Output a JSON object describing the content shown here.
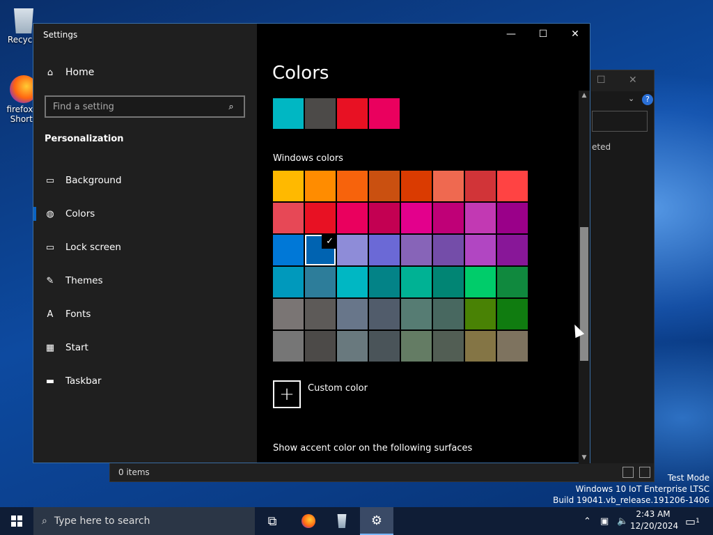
{
  "desktop": {
    "icons": [
      {
        "label": "Recycle"
      },
      {
        "label": "firefox.e Shortc"
      }
    ]
  },
  "explorer": {
    "column_fragment": "eted",
    "status_text": "0 items",
    "caption_maximize": "☐",
    "caption_close": "✕"
  },
  "settings": {
    "app_title": "Settings",
    "home_label": "Home",
    "search_placeholder": "Find a setting",
    "section_title": "Personalization",
    "nav": [
      {
        "label": "Background",
        "icon": "picture-icon",
        "glyph": "▭"
      },
      {
        "label": "Colors",
        "icon": "palette-icon",
        "glyph": "◍"
      },
      {
        "label": "Lock screen",
        "icon": "lock-screen-icon",
        "glyph": "▭"
      },
      {
        "label": "Themes",
        "icon": "themes-icon",
        "glyph": "✎"
      },
      {
        "label": "Fonts",
        "icon": "fonts-icon",
        "glyph": "A"
      },
      {
        "label": "Start",
        "icon": "start-icon",
        "glyph": "▦"
      },
      {
        "label": "Taskbar",
        "icon": "taskbar-icon",
        "glyph": "▬"
      }
    ],
    "active_nav": "Colors",
    "page_title": "Colors",
    "recent_colors": [
      "#00B7C3",
      "#4C4A48",
      "#E81123",
      "#EA005E"
    ],
    "windows_colors_label": "Windows colors",
    "windows_colors": [
      [
        "#FFB900",
        "#FF8C00",
        "#F7630C",
        "#CA5010",
        "#DA3B01",
        "#EF6950",
        "#D13438",
        "#FF4343"
      ],
      [
        "#E74856",
        "#E81123",
        "#EA005E",
        "#C30052",
        "#E3008C",
        "#BF0077",
        "#C239B3",
        "#9A0089"
      ],
      [
        "#0078D7",
        "#0063B1",
        "#8E8CD8",
        "#6B69D6",
        "#8764B8",
        "#744DA9",
        "#B146C2",
        "#881798"
      ],
      [
        "#0099BC",
        "#2D7D9A",
        "#00B7C3",
        "#038387",
        "#00B294",
        "#018574",
        "#00CC6A",
        "#10893E"
      ],
      [
        "#7A7574",
        "#5D5A58",
        "#68768A",
        "#515C6B",
        "#567C73",
        "#486860",
        "#498205",
        "#107C10"
      ],
      [
        "#767676",
        "#4C4A48",
        "#69797E",
        "#4A5459",
        "#647C64",
        "#525E54",
        "#847545",
        "#7E735F"
      ]
    ],
    "selected_color": {
      "row": 2,
      "col": 1
    },
    "custom_color_label": "Custom color",
    "surfaces_label": "Show accent color on the following surfaces",
    "caption_minimize": "—",
    "caption_maximize": "☐",
    "caption_close": "✕"
  },
  "watermark": {
    "line1": "Test Mode",
    "line2": "Windows 10 IoT Enterprise LTSC",
    "line3": "Build 19041.vb_release.191206-1406"
  },
  "taskbar": {
    "search_placeholder": "Type here to search",
    "time": "2:43 AM",
    "date": "12/20/2024",
    "notification_count": "1"
  }
}
